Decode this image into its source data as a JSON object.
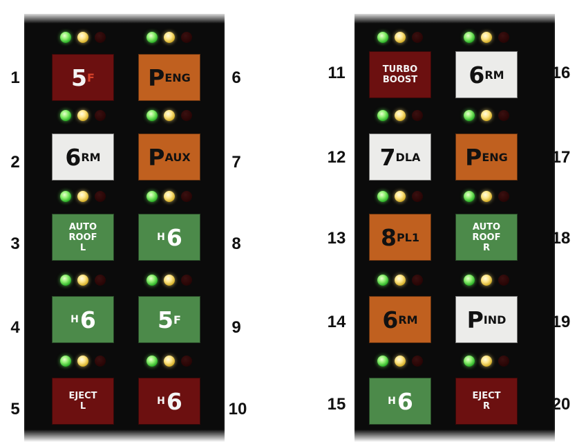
{
  "numbers": {
    "n1": "1",
    "n2": "2",
    "n3": "3",
    "n4": "4",
    "n5": "5",
    "n6": "6",
    "n7": "7",
    "n8": "8",
    "n9": "9",
    "n10": "10",
    "n11": "11",
    "n12": "12",
    "n13": "13",
    "n14": "14",
    "n15": "15",
    "n16": "16",
    "n17": "17",
    "n18": "18",
    "n19": "19",
    "n20": "20"
  },
  "indicators": {
    "colors": [
      "green",
      "yellow",
      "red-off"
    ]
  },
  "buttons": {
    "b1": {
      "big": "5",
      "sub": "F",
      "color": "#6c1010"
    },
    "b2": {
      "big": "6",
      "sub": "RM",
      "color": "#ececea"
    },
    "b3": {
      "text": "AUTO\nROOF\nL",
      "color": "#4c8a4a"
    },
    "b4": {
      "pre": "H",
      "big": "6",
      "color": "#4c8a4a"
    },
    "b5": {
      "text": "EJECT\nL",
      "color": "#6c1010"
    },
    "b6": {
      "big": "P",
      "sub": "ENG",
      "color": "#c0601f"
    },
    "b7": {
      "big": "P",
      "sub": "AUX",
      "color": "#c0601f"
    },
    "b8": {
      "pre": "H",
      "big": "6",
      "color": "#4c8a4a"
    },
    "b9": {
      "big": "5",
      "sub": "F",
      "color": "#4c8a4a"
    },
    "b10": {
      "pre": "H",
      "big": "6",
      "color": "#6c1010"
    },
    "b11": {
      "text": "TURBO\nBOOST",
      "color": "#6c1010"
    },
    "b12": {
      "big": "7",
      "sub": "DLA",
      "color": "#ececea"
    },
    "b13": {
      "big": "8",
      "sub": "PL1",
      "color": "#c0601f"
    },
    "b14": {
      "big": "6",
      "sub": "RM",
      "color": "#c0601f"
    },
    "b15": {
      "pre": "H",
      "big": "6",
      "color": "#4c8a4a"
    },
    "b16": {
      "big": "6",
      "sub": "RM",
      "color": "#ececea"
    },
    "b17": {
      "big": "P",
      "sub": "ENG",
      "color": "#c0601f"
    },
    "b18": {
      "text": "AUTO\nROOF\nR",
      "color": "#4c8a4a"
    },
    "b19": {
      "big": "P",
      "sub": "IND",
      "color": "#ececea"
    },
    "b20": {
      "text": "EJECT\nR",
      "color": "#6c1010"
    }
  }
}
